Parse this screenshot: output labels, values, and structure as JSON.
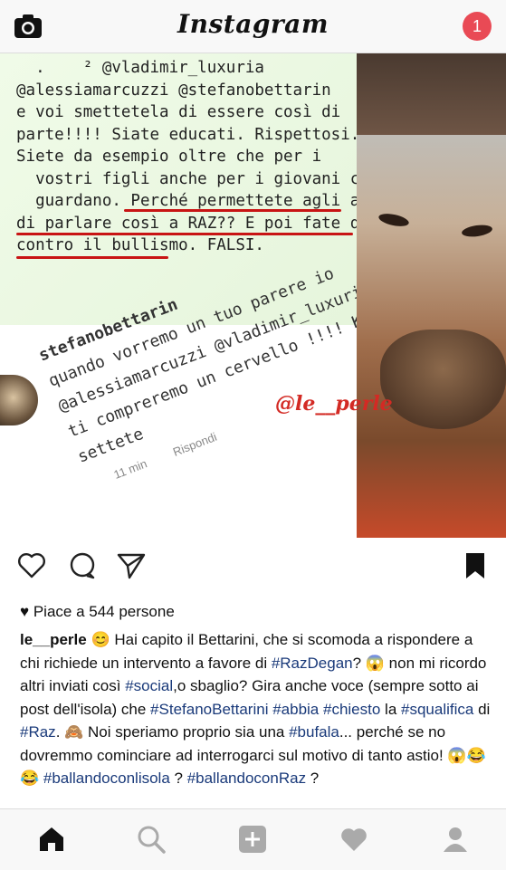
{
  "header": {
    "title": "Instagram",
    "notification_count": "1"
  },
  "post": {
    "image": {
      "note_lines": [
        "  .    ² @vladimir_luxuria",
        "@alessiamarcuzzi @stefanobettarin",
        "e voi smettetela di essere così di",
        "parte!!!! Siate educati. Rispettosi.",
        "Siete da esempio oltre che per i",
        "  vostri figli anche per i giovani che vi",
        "  guardano. Perché permettete agli altri",
        "di parlare così a RAZ?? E poi fate quelli",
        "contro il bullismo. FALSI."
      ],
      "comment_lines": [
        "stefanobettarin",
        "quando vorremo un tuo parere io",
        "@alessiamarcuzzi @vladimir_luxuria",
        "ti compreremo un cervello !!!! Ku ku",
        "settete"
      ],
      "comment_time": "11 min",
      "comment_reply": "Rispondi",
      "watermark": "@le__perle"
    },
    "likes_text": "Piace a 544 persone",
    "caption": {
      "username": "le__perle",
      "parts": [
        {
          "t": "text",
          "v": " 😊 Hai capito il Bettarini, che si scomoda a rispondere a chi richiede un intervento a favore di "
        },
        {
          "t": "tag",
          "v": "#RazDegan"
        },
        {
          "t": "text",
          "v": "? 😱 non mi ricordo altri inviati così "
        },
        {
          "t": "tag",
          "v": "#social"
        },
        {
          "t": "text",
          "v": ",o sbaglio? Gira anche voce (sempre sotto ai post dell'isola) che "
        },
        {
          "t": "tag",
          "v": "#StefanoBettarini"
        },
        {
          "t": "text",
          "v": " "
        },
        {
          "t": "tag",
          "v": "#abbia"
        },
        {
          "t": "text",
          "v": " "
        },
        {
          "t": "tag",
          "v": "#chiesto"
        },
        {
          "t": "text",
          "v": " la "
        },
        {
          "t": "tag",
          "v": "#squalifica"
        },
        {
          "t": "text",
          "v": " di "
        },
        {
          "t": "tag",
          "v": "#Raz"
        },
        {
          "t": "text",
          "v": ". 🙈 Noi speriamo proprio sia una "
        },
        {
          "t": "tag",
          "v": "#bufala"
        },
        {
          "t": "text",
          "v": "... perché se no dovremmo cominciare ad interrogarci sul motivo di tanto astio! 😱😂😂 "
        },
        {
          "t": "tag",
          "v": "#ballandoconlisola"
        },
        {
          "t": "text",
          "v": " ? "
        },
        {
          "t": "tag",
          "v": "#ballandoconRaz"
        },
        {
          "t": "text",
          "v": " ?"
        }
      ]
    }
  },
  "icons": {
    "camera": "camera-icon",
    "like": "heart-outline-icon",
    "comment": "comment-bubble-icon",
    "share": "paper-plane-icon",
    "save": "bookmark-icon",
    "home": "home-icon",
    "search": "search-icon",
    "add": "add-post-icon",
    "activity": "heart-icon",
    "profile": "profile-icon"
  },
  "colors": {
    "notification": "#e94a55",
    "underline": "#c81414",
    "watermark": "#d32a24",
    "hashtag": "#1a3a7a"
  }
}
